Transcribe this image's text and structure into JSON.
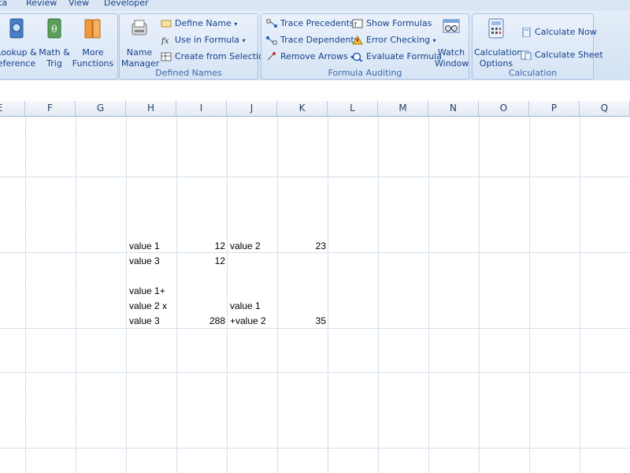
{
  "tabs": [
    "ta",
    "Review",
    "View",
    "Developer"
  ],
  "groups": {
    "function_library": {
      "lookup": "Lookup &\neference",
      "math": "Math &\nTrig",
      "more": "More\nFunctions"
    },
    "defined_names": {
      "label": "Defined Names",
      "name_manager": "Name\nManager",
      "define_name": "Define Name",
      "use_in_formula": "Use in Formula",
      "create_from_selection": "Create from Selection"
    },
    "formula_auditing": {
      "label": "Formula Auditing",
      "trace_precedents": "Trace Precedents",
      "trace_dependents": "Trace Dependents",
      "remove_arrows": "Remove Arrows",
      "show_formulas": "Show Formulas",
      "error_checking": "Error Checking",
      "evaluate_formula": "Evaluate Formula",
      "watch_window": "Watch\nWindow"
    },
    "calculation": {
      "label": "Calculation",
      "options": "Calculation\nOptions",
      "calc_now": "Calculate Now",
      "calc_sheet": "Calculate Sheet"
    }
  },
  "columns": [
    "E",
    "F",
    "G",
    "H",
    "I",
    "J",
    "K",
    "L",
    "M",
    "N",
    "O",
    "P",
    "Q"
  ],
  "cells": {
    "h1": "value 1",
    "i1": "12",
    "j1": "value 2",
    "k1": "23",
    "h2": "value 3",
    "i2": "12",
    "h4": "value 1+",
    "h5": "value 2 x",
    "j5": "value 1",
    "h6": "value 3",
    "i6": "288",
    "j6": "+value 2",
    "k6": "35"
  }
}
